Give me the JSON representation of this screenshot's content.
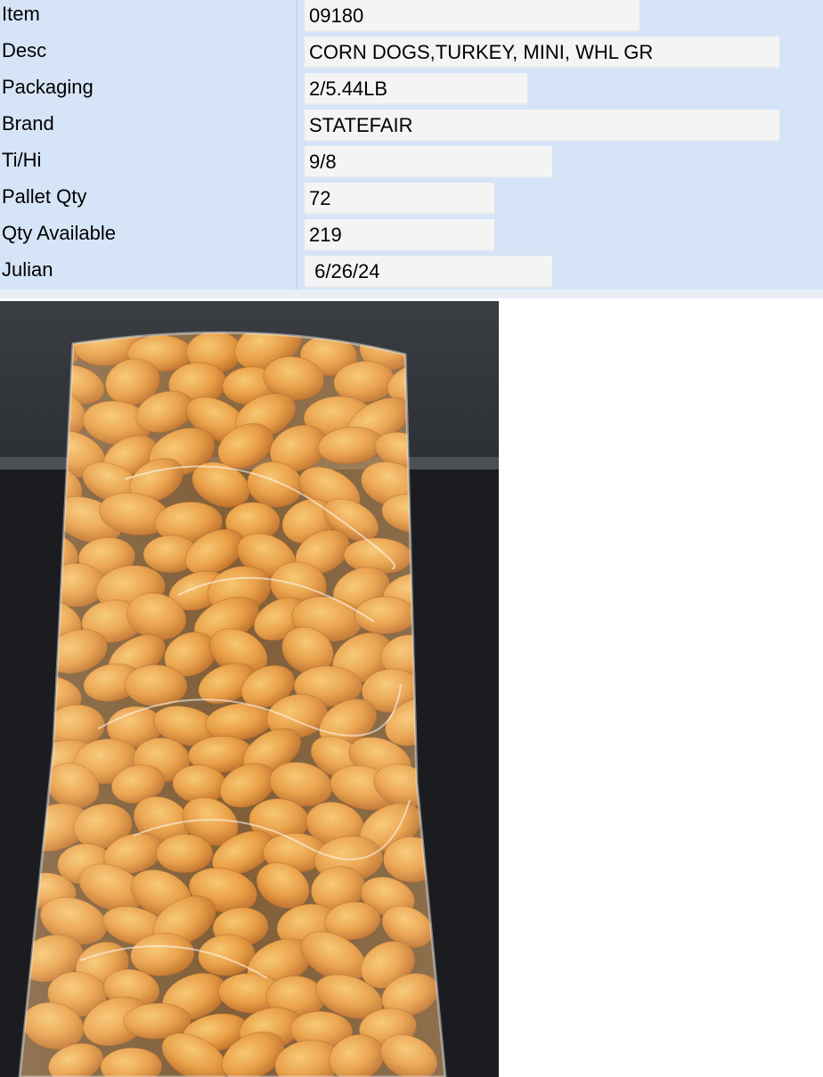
{
  "fields": [
    {
      "label": "Item",
      "value": "09180"
    },
    {
      "label": "Desc",
      "value": "CORN DOGS,TURKEY, MINI, WHL GR"
    },
    {
      "label": "Packaging",
      "value": "2/5.44LB"
    },
    {
      "label": "Brand",
      "value": "STATEFAIR"
    },
    {
      "label": "Ti/Hi",
      "value": "9/8"
    },
    {
      "label": "Pallet Qty",
      "value": "72"
    },
    {
      "label": "Qty Available",
      "value": "219"
    },
    {
      "label": "Julian",
      "value": " 6/26/24"
    }
  ],
  "colors": {
    "panel_bg": "#d6e4f7",
    "field_bg": "#f4f4f4",
    "nugget": "#e89a3c",
    "background_dark": "#1f2227"
  },
  "photo": {
    "icon": "product-photo"
  }
}
